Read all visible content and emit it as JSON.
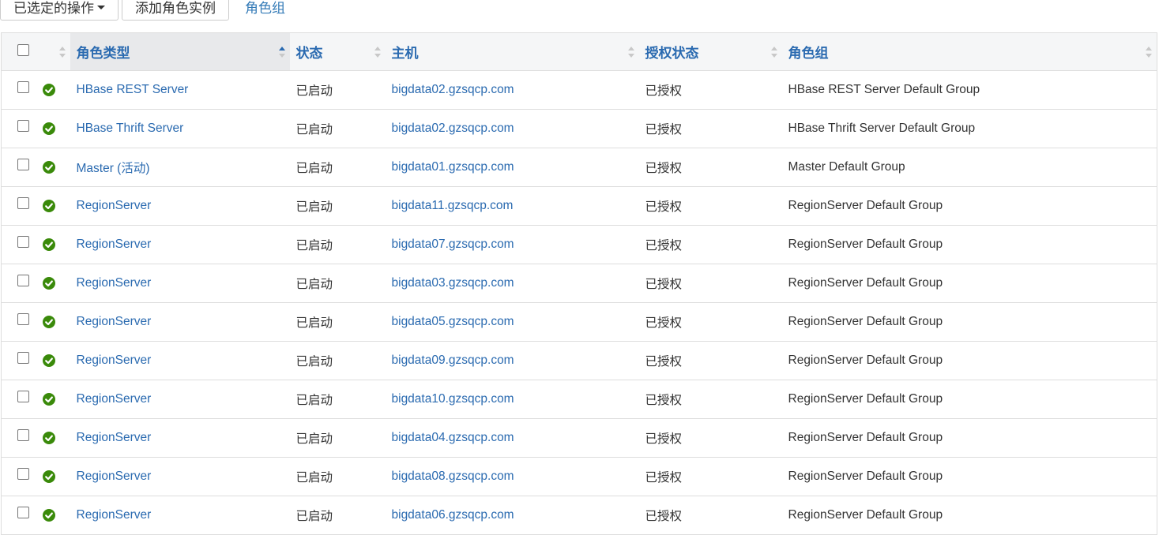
{
  "toolbar": {
    "selected_actions_label": "已选定的操作",
    "add_role_instance_label": "添加角色实例",
    "role_groups_link": "角色组"
  },
  "table": {
    "headers": {
      "role_type": "角色类型",
      "status": "状态",
      "host": "主机",
      "auth_status": "授权状态",
      "role_group": "角色组"
    },
    "sorted_column": "role_type",
    "sort_direction": "ascending",
    "rows": [
      {
        "role_type": "HBase REST Server",
        "status": "已启动",
        "host": "bigdata02.gzsqcp.com",
        "auth_status": "已授权",
        "role_group": "HBase REST Server Default Group"
      },
      {
        "role_type": "HBase Thrift Server",
        "status": "已启动",
        "host": "bigdata02.gzsqcp.com",
        "auth_status": "已授权",
        "role_group": "HBase Thrift Server Default Group"
      },
      {
        "role_type": "Master (活动)",
        "status": "已启动",
        "host": "bigdata01.gzsqcp.com",
        "auth_status": "已授权",
        "role_group": "Master Default Group"
      },
      {
        "role_type": "RegionServer",
        "status": "已启动",
        "host": "bigdata11.gzsqcp.com",
        "auth_status": "已授权",
        "role_group": "RegionServer Default Group"
      },
      {
        "role_type": "RegionServer",
        "status": "已启动",
        "host": "bigdata07.gzsqcp.com",
        "auth_status": "已授权",
        "role_group": "RegionServer Default Group"
      },
      {
        "role_type": "RegionServer",
        "status": "已启动",
        "host": "bigdata03.gzsqcp.com",
        "auth_status": "已授权",
        "role_group": "RegionServer Default Group"
      },
      {
        "role_type": "RegionServer",
        "status": "已启动",
        "host": "bigdata05.gzsqcp.com",
        "auth_status": "已授权",
        "role_group": "RegionServer Default Group"
      },
      {
        "role_type": "RegionServer",
        "status": "已启动",
        "host": "bigdata09.gzsqcp.com",
        "auth_status": "已授权",
        "role_group": "RegionServer Default Group"
      },
      {
        "role_type": "RegionServer",
        "status": "已启动",
        "host": "bigdata10.gzsqcp.com",
        "auth_status": "已授权",
        "role_group": "RegionServer Default Group"
      },
      {
        "role_type": "RegionServer",
        "status": "已启动",
        "host": "bigdata04.gzsqcp.com",
        "auth_status": "已授权",
        "role_group": "RegionServer Default Group"
      },
      {
        "role_type": "RegionServer",
        "status": "已启动",
        "host": "bigdata08.gzsqcp.com",
        "auth_status": "已授权",
        "role_group": "RegionServer Default Group"
      },
      {
        "role_type": "RegionServer",
        "status": "已启动",
        "host": "bigdata06.gzsqcp.com",
        "auth_status": "已授权",
        "role_group": "RegionServer Default Group"
      }
    ]
  },
  "icons": {
    "row_status": "check-circle-icon",
    "sort": "sort-arrows-icon"
  },
  "colors": {
    "link": "#2a6ab0",
    "ok_green": "#3a8a0a",
    "header_bg": "#f5f6f7",
    "border": "#dddddd"
  }
}
